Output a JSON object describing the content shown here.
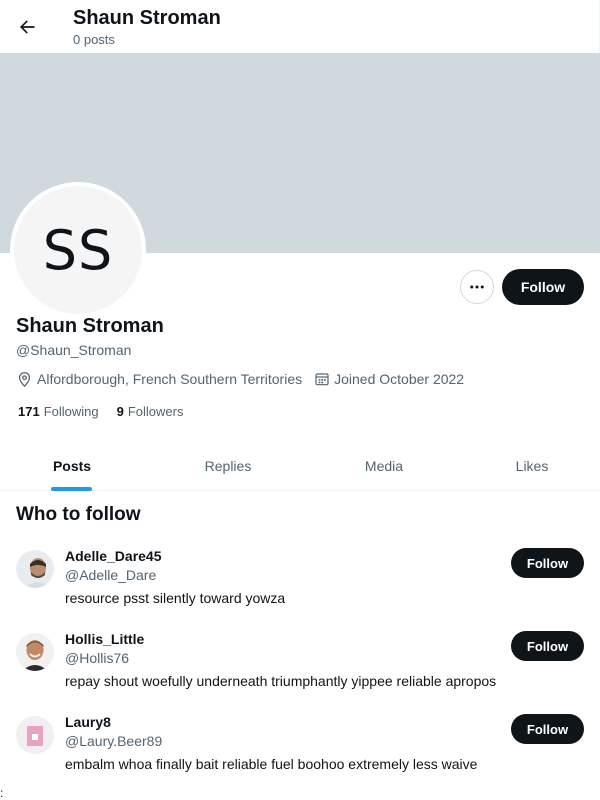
{
  "header": {
    "title": "Shaun Stroman",
    "post_count": "0 posts"
  },
  "profile": {
    "avatar_initials": "SS",
    "name": "Shaun Stroman",
    "handle": "@Shaun_Stroman",
    "location": "Alfordborough, French Southern Territories",
    "joined": "Joined October 2022",
    "following_count": "171",
    "following_label": "Following",
    "followers_count": "9",
    "followers_label": "Followers",
    "follow_label": "Follow",
    "banner_color": "#cfd9de"
  },
  "tabs": [
    {
      "label": "Posts",
      "active": true
    },
    {
      "label": "Replies",
      "active": false
    },
    {
      "label": "Media",
      "active": false
    },
    {
      "label": "Likes",
      "active": false
    }
  ],
  "who_to_follow": {
    "title": "Who to follow",
    "items": [
      {
        "name": "Adelle_Dare45",
        "handle": "@Adelle_Dare",
        "bio": "resource psst silently toward yowza",
        "follow_label": "Follow"
      },
      {
        "name": "Hollis_Little",
        "handle": "@Hollis76",
        "bio": "repay shout woefully underneath triumphantly yippee reliable apropos",
        "follow_label": "Follow"
      },
      {
        "name": "Laury8",
        "handle": "@Laury.Beer89",
        "bio": "embalm whoa finally bait reliable fuel boohoo extremely less waive",
        "follow_label": "Follow"
      }
    ]
  },
  "stray_text": ":",
  "colors": {
    "accent": "#1d9bf0",
    "button_dark": "#0f1419",
    "secondary_text": "#536471"
  }
}
